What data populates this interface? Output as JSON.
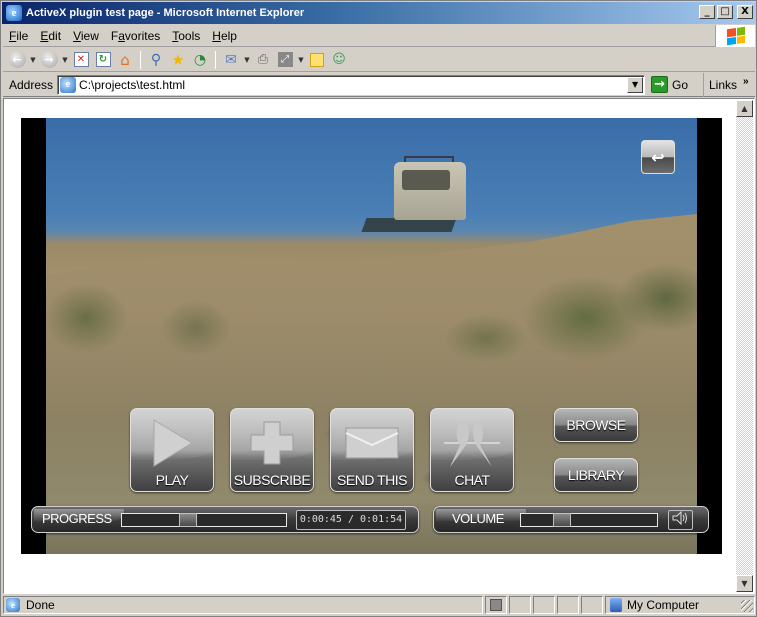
{
  "window": {
    "title": "ActiveX plugin test page - Microsoft Internet Explorer",
    "controls": {
      "minimize": "_",
      "maximize": "□",
      "close": "X"
    }
  },
  "menu": [
    {
      "label": "File",
      "accel": "F"
    },
    {
      "label": "Edit",
      "accel": "E"
    },
    {
      "label": "View",
      "accel": "V"
    },
    {
      "label": "Favorites",
      "accel": "a"
    },
    {
      "label": "Tools",
      "accel": "T"
    },
    {
      "label": "Help",
      "accel": "H"
    }
  ],
  "toolbar": {
    "icons": [
      "back-icon",
      "forward-icon",
      "stop-icon",
      "refresh-icon",
      "home-icon",
      "search-icon",
      "favorites-icon",
      "history-icon",
      "mail-icon",
      "print-icon",
      "fullscreen-icon",
      "notes-icon",
      "messenger-icon"
    ]
  },
  "address": {
    "label": "Address",
    "value": "C:\\projects\\test.html",
    "go_label": "Go",
    "links_label": "Links",
    "links_chevron": "»"
  },
  "player": {
    "back_glyph": "↩",
    "buttons": [
      {
        "id": "play",
        "label": "PLAY",
        "icon": "play-icon"
      },
      {
        "id": "subscribe",
        "label": "SUBSCRIBE",
        "icon": "plus-icon"
      },
      {
        "id": "send",
        "label": "SEND THIS",
        "icon": "envelope-icon"
      },
      {
        "id": "chat",
        "label": "CHAT",
        "icon": "birds-icon"
      }
    ],
    "side_buttons": [
      {
        "id": "browse",
        "label": "BROWSE"
      },
      {
        "id": "library",
        "label": "LIBRARY"
      }
    ],
    "progress": {
      "label": "PROGRESS",
      "time_display": "0:00:45 / 0:01:54",
      "current": "0:00:45",
      "total": "0:01:54",
      "fraction": 0.39
    },
    "volume": {
      "label": "VOLUME",
      "fraction": 0.27,
      "speaker_glyph": "🔊"
    }
  },
  "status": {
    "text": "Done",
    "zone": "My Computer"
  }
}
